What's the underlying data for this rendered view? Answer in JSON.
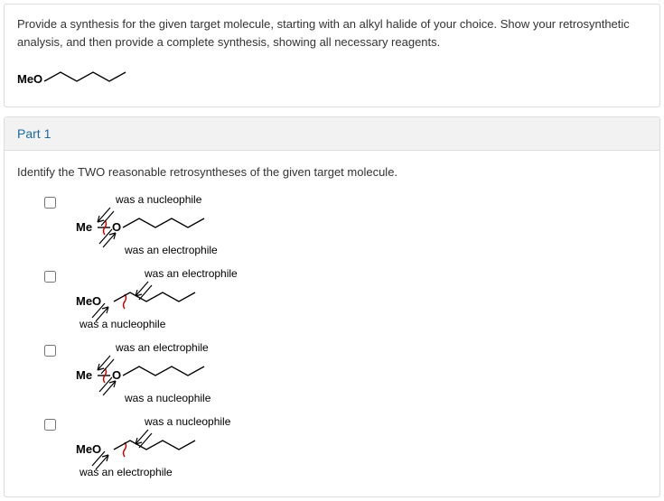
{
  "prompt": {
    "text": "Provide a synthesis for the given target molecule, starting with an alkyl halide of your choice. Show your retrosynthetic analysis, and then provide a complete synthesis, showing all necessary reagents.",
    "target_label": "MeO"
  },
  "part": {
    "title": "Part 1",
    "instruction": "Identify the TWO reasonable retrosyntheses of the given target molecule."
  },
  "options": [
    {
      "upper_label": "was a nucleophile",
      "lower_label": "was an electrophile",
      "left_text": "Me",
      "center_text": "O",
      "cut_left": true
    },
    {
      "upper_label": "was an electrophile",
      "lower_label": "was a nucleophile",
      "left_text": "MeO",
      "center_text": "",
      "cut_left": false
    },
    {
      "upper_label": "was an electrophile",
      "lower_label": "was a nucleophile",
      "left_text": "Me",
      "center_text": "O",
      "cut_left": true
    },
    {
      "upper_label": "was a nucleophile",
      "lower_label": "was an electrophile",
      "left_text": "MeO",
      "center_text": "",
      "cut_left": false
    }
  ]
}
